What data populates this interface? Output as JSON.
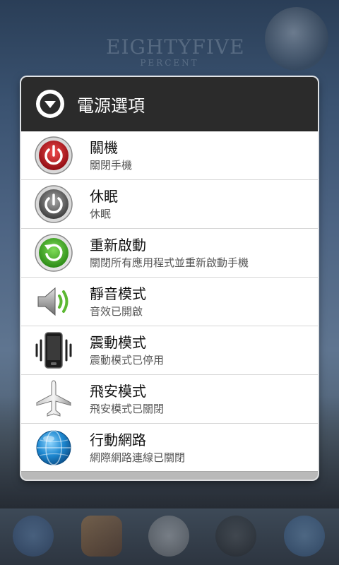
{
  "wallpaper": {
    "brand_line1": "EIGHTYFIVE",
    "brand_line2": "PERCENT"
  },
  "dialog": {
    "title": "電源選項",
    "header_icon": "chevron-down-circle-icon",
    "items": [
      {
        "title": "關機",
        "subtitle": "關閉手機",
        "icon": "power-red-icon"
      },
      {
        "title": "休眠",
        "subtitle": "休眠",
        "icon": "power-gray-icon"
      },
      {
        "title": "重新啟動",
        "subtitle": "關閉所有應用程式並重新啟動手機",
        "icon": "restart-icon"
      },
      {
        "title": "靜音模式",
        "subtitle": "音效已開啟",
        "icon": "speaker-icon"
      },
      {
        "title": "震動模式",
        "subtitle": "震動模式已停用",
        "icon": "vibrate-phone-icon"
      },
      {
        "title": "飛安模式",
        "subtitle": "飛安模式已關閉",
        "icon": "airplane-icon"
      },
      {
        "title": "行動網路",
        "subtitle": "網際網路連線已關閉",
        "icon": "globe-icon"
      }
    ]
  },
  "colors": {
    "header_bg": "#2b2b2b",
    "power_red": "#c0121c",
    "restart_green": "#3fa52a",
    "globe_blue": "#1e88d0"
  }
}
